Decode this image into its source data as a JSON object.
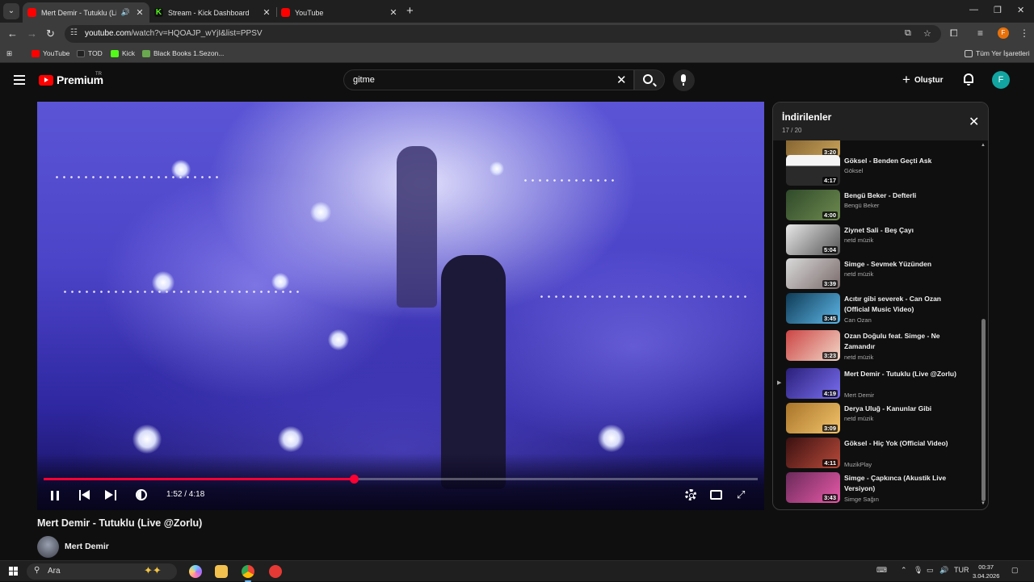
{
  "browser": {
    "tabs": [
      {
        "title": "Mert Demir - Tutuklu (Live",
        "favicon": "youtube-icon",
        "playing_audio": true
      },
      {
        "title": "Stream - Kick Dashboard",
        "favicon": "kick-icon"
      },
      {
        "title": "YouTube",
        "favicon": "youtube-icon"
      }
    ],
    "url_host": "youtube.com",
    "url_path": "/watch?v=HQOAJP_wYjI&list=PPSV",
    "profile_initial": "F",
    "bookmarks": [
      "YouTube",
      "TOD",
      "Kick",
      "Black Books 1.Sezon..."
    ],
    "all_bookmarks_label": "Tüm Yer İşaretleri"
  },
  "masthead": {
    "brand": "Premium",
    "region": "TR",
    "search_value": "gitme",
    "create_label": "Oluştur",
    "avatar_initial": "F"
  },
  "player": {
    "current_time": "1:52",
    "duration": "4:18",
    "time_display": "1:52 / 4:18",
    "progress_fraction": 0.434,
    "accent_color": "#ff0033"
  },
  "video": {
    "title": "Mert Demir - Tutuklu (Live @Zorlu)",
    "channel": "Mert Demir"
  },
  "playlist": {
    "title": "İndirilenler",
    "position": "17 / 20",
    "items": [
      {
        "title": "",
        "channel": "",
        "duration": "3:20"
      },
      {
        "title": "Göksel - Benden Geçti Ask",
        "channel": "Göksel",
        "duration": "4:17"
      },
      {
        "title": "Bengü Beker - Defterli",
        "channel": "Bengü Beker",
        "duration": "4:00"
      },
      {
        "title": "Ziynet Sali - Beş Çayı",
        "channel": "netd müzik",
        "duration": "5:04"
      },
      {
        "title": "Simge - Sevmek Yüzünden",
        "channel": "netd müzik",
        "duration": "3:39"
      },
      {
        "title": "Acıtır gibi severek - Can Ozan (Official Music Video)",
        "channel": "Can Ozan",
        "duration": "3:45"
      },
      {
        "title": "Ozan Doğulu feat. Simge - Ne Zamandır",
        "channel": "netd müzik",
        "duration": "3:23"
      },
      {
        "title": "Mert Demir - Tutuklu (Live @Zorlu)",
        "channel": "Mert Demir",
        "duration": "4:19",
        "current": true
      },
      {
        "title": "Derya Uluğ - Kanunlar Gibi",
        "channel": "netd müzik",
        "duration": "3:09"
      },
      {
        "title": "Göksel - Hiç Yok (Official Video)",
        "channel": "MuzikPlay",
        "duration": "4:11"
      },
      {
        "title": "Simge - Çapkınca (Akustik Live Versiyon)",
        "channel": "Simge Sağın",
        "duration": "3:43"
      }
    ]
  },
  "taskbar": {
    "search_label": "Ara",
    "language": "TUR",
    "time": "00:37",
    "date": "3.04.2026"
  }
}
